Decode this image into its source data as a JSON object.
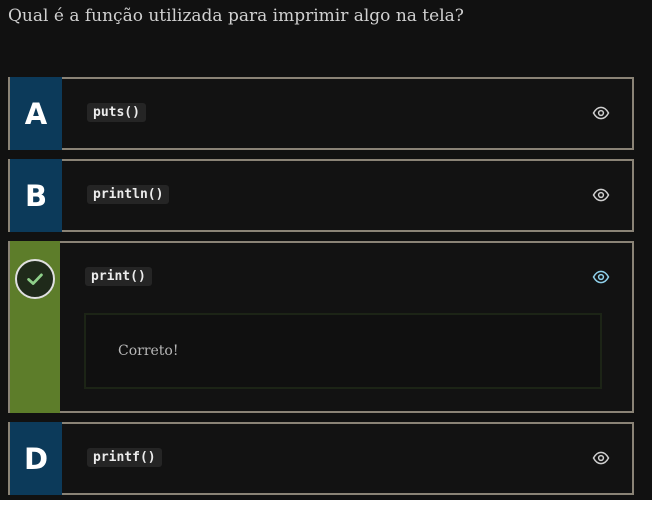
{
  "question": "Qual é a função utilizada para imprimir algo na tela?",
  "options": [
    {
      "letter": "A",
      "code": "puts()",
      "correct": false,
      "eye_color": "#cfcfcf"
    },
    {
      "letter": "B",
      "code": "println()",
      "correct": false,
      "eye_color": "#cfcfcf"
    },
    {
      "letter": "",
      "code": "print()",
      "correct": true,
      "eye_color": "#8fd0ea",
      "feedback": "Correto!"
    },
    {
      "letter": "D",
      "code": "printf()",
      "correct": false,
      "eye_color": "#cfcfcf"
    }
  ],
  "colors": {
    "letter_bg": "#0c3a5a",
    "correct_bg": "#5d7d2a",
    "border": "#8a8376",
    "background": "#111111"
  },
  "icons": {
    "reveal": "eye-icon",
    "correct": "checkmark-icon"
  }
}
